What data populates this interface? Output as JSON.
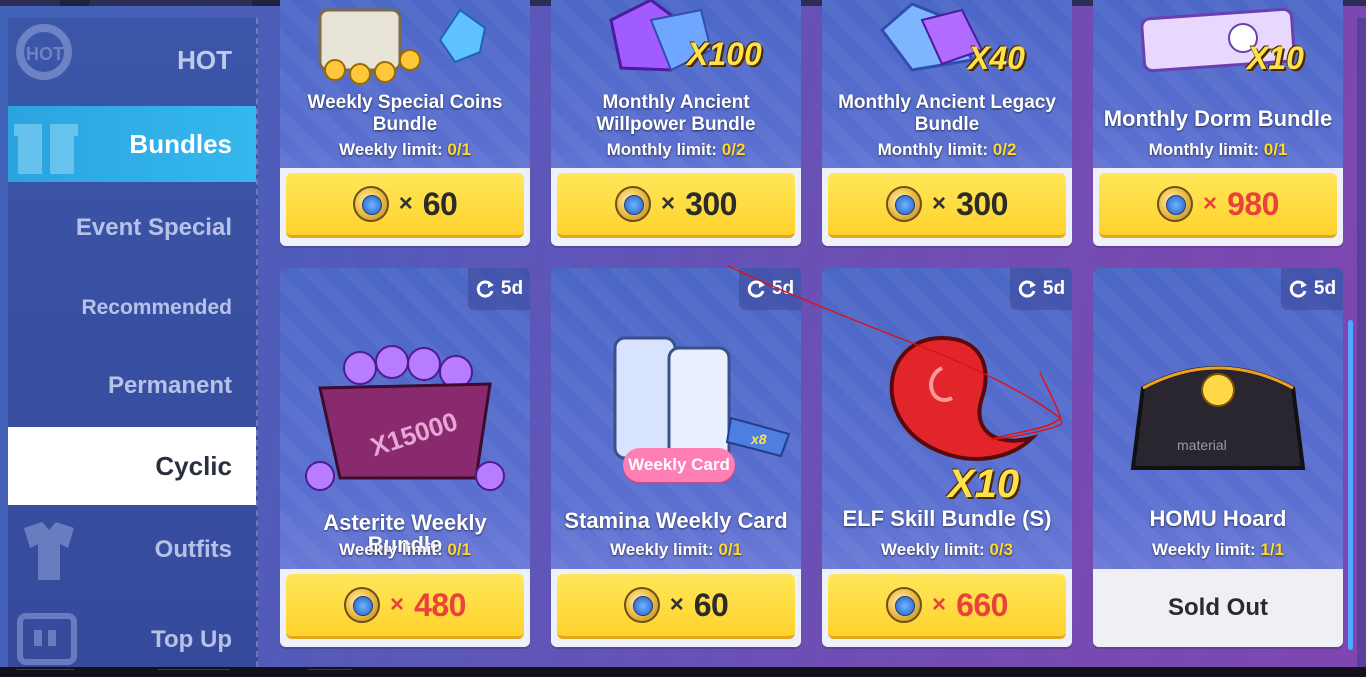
{
  "colors": {
    "accent": "#2aa4df",
    "price_button": "#ffd22c",
    "price_red": "#e8423b",
    "limit_highlight": "#ffd92e"
  },
  "sidebar": {
    "items": [
      {
        "label": "HOT",
        "state": "normal"
      },
      {
        "label": "Bundles",
        "state": "highlighted"
      },
      {
        "label": "Event Special",
        "state": "normal"
      },
      {
        "label": "Recommended",
        "state": "normal"
      },
      {
        "label": "Permanent",
        "state": "normal"
      },
      {
        "label": "Cyclic",
        "state": "selected"
      },
      {
        "label": "Outfits",
        "state": "normal"
      },
      {
        "label": "Top Up",
        "state": "normal"
      }
    ]
  },
  "cards": [
    {
      "title": "Weekly Special Coins Bundle",
      "limit_label": "Weekly limit:",
      "limit": "0/1",
      "currency_icon": "crystal-coin-icon",
      "times": "×",
      "price": "60"
    },
    {
      "title": "Monthly Ancient Willpower Bundle",
      "limit_label": "Monthly limit:",
      "limit": "0/2",
      "multiplier": "X100",
      "currency_icon": "crystal-coin-icon",
      "times": "×",
      "price": "300"
    },
    {
      "title": "Monthly Ancient Legacy Bundle",
      "limit_label": "Monthly limit:",
      "limit": "0/2",
      "multiplier": "X40",
      "currency_icon": "crystal-coin-icon",
      "times": "×",
      "price": "300"
    },
    {
      "title": "Monthly Dorm Bundle",
      "limit_label": "Monthly limit:",
      "limit": "0/1",
      "multiplier": "X10",
      "currency_icon": "crystal-coin-icon",
      "times": "×",
      "price": "980"
    },
    {
      "title": "Asterite Weekly Bundle",
      "limit_label": "Weekly limit:",
      "limit": "0/1",
      "timer": "5d",
      "box_text": "X15000",
      "currency_icon": "crystal-coin-icon",
      "times": "×",
      "price": "480"
    },
    {
      "title": "Stamina Weekly Card",
      "limit_label": "Weekly limit:",
      "limit": "0/1",
      "timer": "5d",
      "tag": "Weekly Card",
      "badge": "x8",
      "currency_icon": "crystal-coin-icon",
      "times": "×",
      "price": "60"
    },
    {
      "title": "ELF Skill Bundle (S)",
      "limit_label": "Weekly limit:",
      "limit": "0/3",
      "timer": "5d",
      "multiplier": "X10",
      "currency_icon": "crystal-coin-icon",
      "times": "×",
      "price": "660"
    },
    {
      "title": "HOMU Hoard",
      "limit_label": "Weekly limit:",
      "limit": "1/1",
      "timer": "5d",
      "box_text": "material",
      "status": "Sold Out"
    }
  ]
}
